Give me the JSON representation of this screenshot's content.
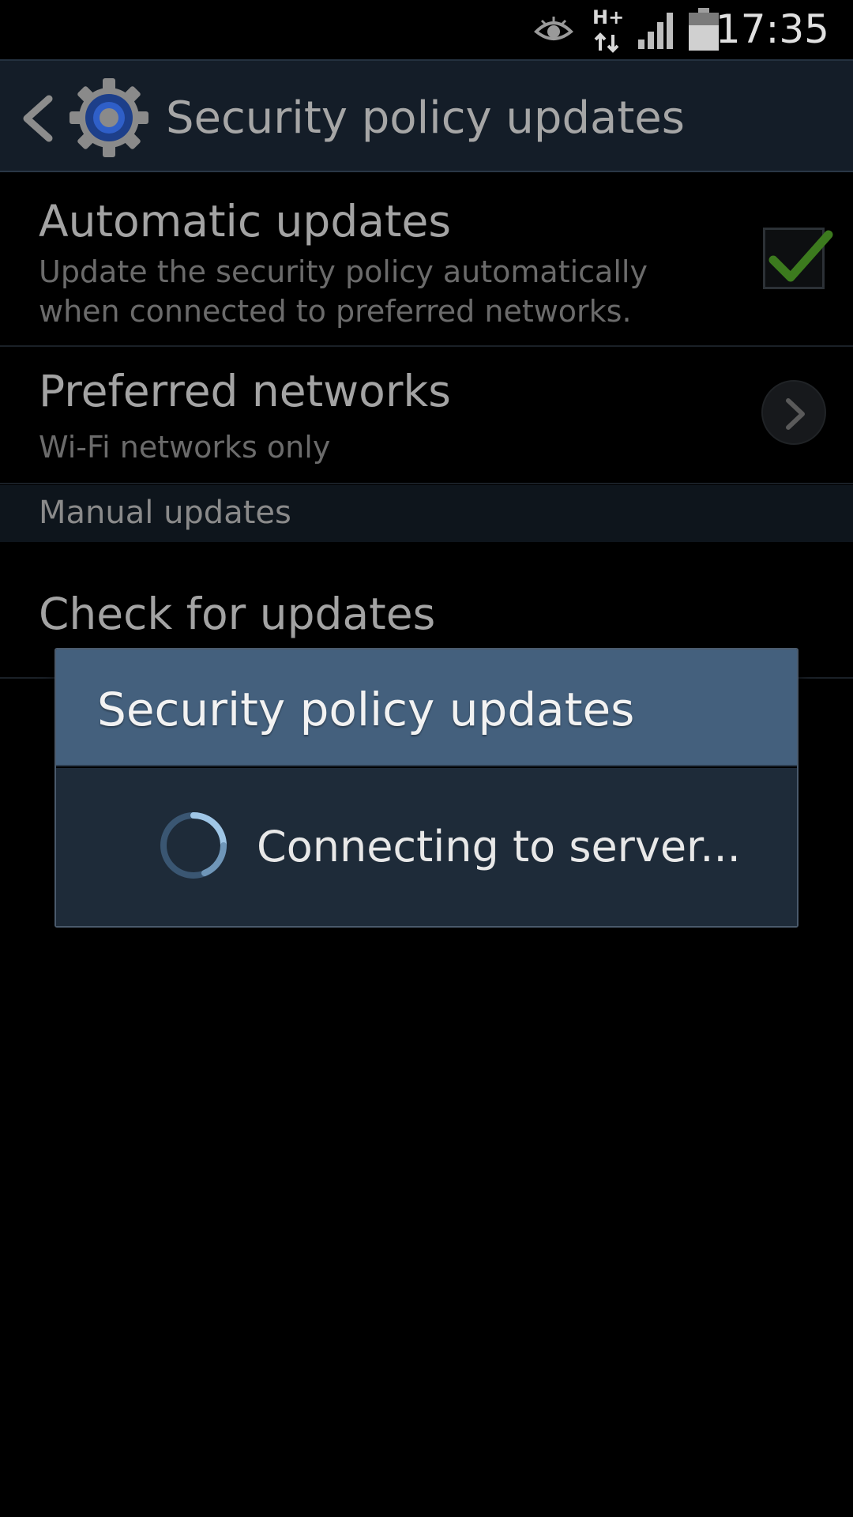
{
  "status_bar": {
    "time": "17:35",
    "network_type": "H+",
    "icons": [
      "eye-icon",
      "network-data-icon",
      "signal-icon",
      "battery-icon"
    ]
  },
  "action_bar": {
    "title": "Security policy updates",
    "back_icon": "chevron-left-icon",
    "app_icon": "settings-gear-icon"
  },
  "settings": {
    "automatic_updates": {
      "title": "Automatic updates",
      "summary": "Update the security policy automatically when connected to preferred networks.",
      "checked": true
    },
    "preferred_networks": {
      "title": "Preferred networks",
      "summary": "Wi-Fi networks only"
    },
    "section_manual": "Manual updates",
    "check_for_updates": {
      "title": "Check for updates"
    }
  },
  "dialog": {
    "title": "Security policy updates",
    "message": "Connecting to server..."
  },
  "colors": {
    "action_bar_bg": "#141d28",
    "dialog_header_bg": "#44607d",
    "dialog_body_bg": "#1e2b39",
    "checkmark": "#3c7a1e"
  }
}
